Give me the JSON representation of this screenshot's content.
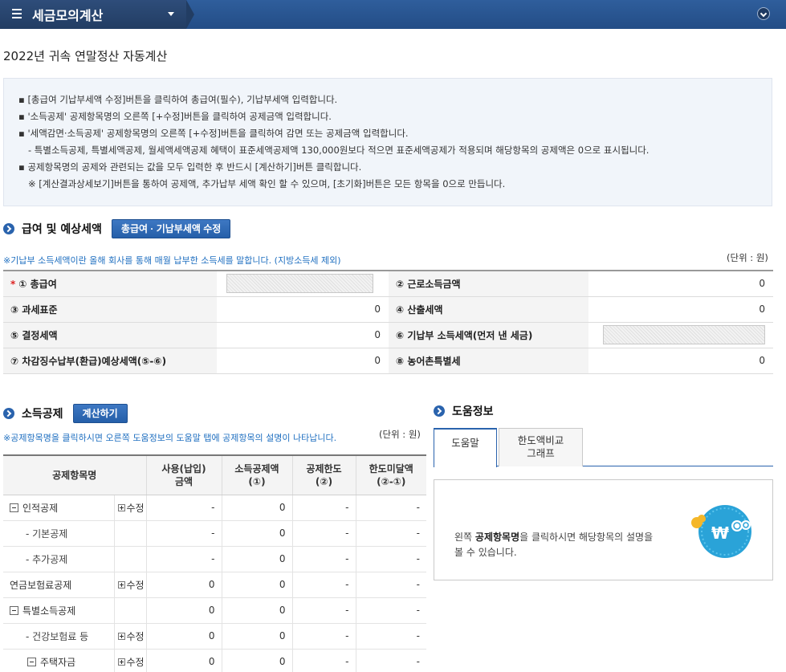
{
  "header": {
    "menu_title": "세금모의계산"
  },
  "page_title": "2022년 귀속 연말정산 자동계산",
  "notice": {
    "lines": [
      "▪ [총급여 기납부세액 수정]버튼을 클릭하여 총급여(필수), 기납부세액 입력합니다.",
      "▪ '소득공제' 공제항목명의 오른쪽 [+수정]버튼을 클릭하여 공제금액 입력합니다.",
      "▪ '세액감면·소득공제' 공제항목명의 오른쪽 [+수정]버튼을 클릭하여 감면 또는 공제금액 입력합니다.",
      "- 특별소득공제, 특별세액공제, 월세액세액공제 혜택이 표준세액공제액 130,000원보다 적으면 표준세액공제가 적용되며 해당항목의 공제액은 0으로 표시됩니다.",
      "▪ 공제항목명의 공제와 관련되는 값을 모두 입력한 후 반드시 [계산하기]버튼 클릭합니다.",
      "※ [계산결과상세보기]버튼을 통하여 공제액, 추가납부 세액 확인 할 수 있으며, [초기화]버튼은 모든 항목을 0으로 만듭니다."
    ]
  },
  "salary_section": {
    "title": "급여 및 예상세액",
    "edit_button": "총급여 · 기납부세액 수정",
    "note": "※기납부 소득세액이란 올해 회사를 통해 매월 납부한 소득세를 말합니다. (지방소득세 제외)",
    "unit": "(단위 : 원)",
    "required_mark": "*",
    "rows": [
      {
        "l1": "① 총급여",
        "v1": "",
        "l2": "② 근로소득금액",
        "v2": "0"
      },
      {
        "l1": "③ 과세표준",
        "v1": "0",
        "l2": "④ 산출세액",
        "v2": "0"
      },
      {
        "l1": "⑤ 결정세액",
        "v1": "0",
        "l2": "⑥ 기납부 소득세액(먼저 낸 세금)",
        "v2": ""
      },
      {
        "l1": "⑦ 차감징수납부(환급)예상세액(⑤-⑥)",
        "v1": "0",
        "l2": "⑧ 농어촌특별세",
        "v2": "0"
      }
    ]
  },
  "deduction_section": {
    "title": "소득공제",
    "calc_button": "계산하기",
    "note": "※공제항목명을 클릭하시면 오른쪽 도움정보의 도움말 탭에 공제항목의 설명이 나타납니다.",
    "unit": "(단위 : 원)",
    "headers": {
      "name": "공제항목명",
      "used_1": "사용(납입)",
      "used_2": "금액",
      "ded_1": "소득공제액",
      "ded_2": "(①)",
      "limit_1": "공제한도",
      "limit_2": "(②)",
      "under_1": "한도미달액",
      "under_2": "(②-①)"
    },
    "edit_label": "수정",
    "rows": [
      {
        "name": "인적공제",
        "level": "top-box",
        "edit": true,
        "used": "-",
        "ded": "0",
        "limit": "-",
        "under": "-"
      },
      {
        "name": "- 기본공제",
        "level": "child",
        "edit": false,
        "used": "-",
        "ded": "0",
        "limit": "-",
        "under": "-"
      },
      {
        "name": "- 추가공제",
        "level": "child",
        "edit": false,
        "used": "-",
        "ded": "0",
        "limit": "-",
        "under": "-"
      },
      {
        "name": "연금보험료공제",
        "level": "top",
        "edit": true,
        "used": "0",
        "ded": "0",
        "limit": "-",
        "under": "-"
      },
      {
        "name": "특별소득공제",
        "level": "top-box",
        "edit": false,
        "used": "0",
        "ded": "0",
        "limit": "-",
        "under": "-"
      },
      {
        "name": "- 건강보험료 등",
        "level": "child",
        "edit": true,
        "used": "0",
        "ded": "0",
        "limit": "-",
        "under": "-"
      },
      {
        "name": "주택자금",
        "level": "child-box",
        "edit": true,
        "used": "0",
        "ded": "0",
        "limit": "-",
        "under": "-"
      }
    ]
  },
  "help_section": {
    "title": "도움정보",
    "tabs": [
      "도움말",
      "한도액비교 그래프"
    ],
    "tab2_line1": "한도액비교",
    "tab2_line2": "그래프",
    "text_pre": "왼쪽 ",
    "text_bold": "공제항목명",
    "text_post": "을 클릭하시면 해당항목의 설명을 볼 수 있습니다.",
    "mascot_symbol": "₩"
  },
  "colors": {
    "header_bg": "#2f5e9c",
    "accent": "#2a63ad",
    "note_blue": "#1f6fc0"
  }
}
